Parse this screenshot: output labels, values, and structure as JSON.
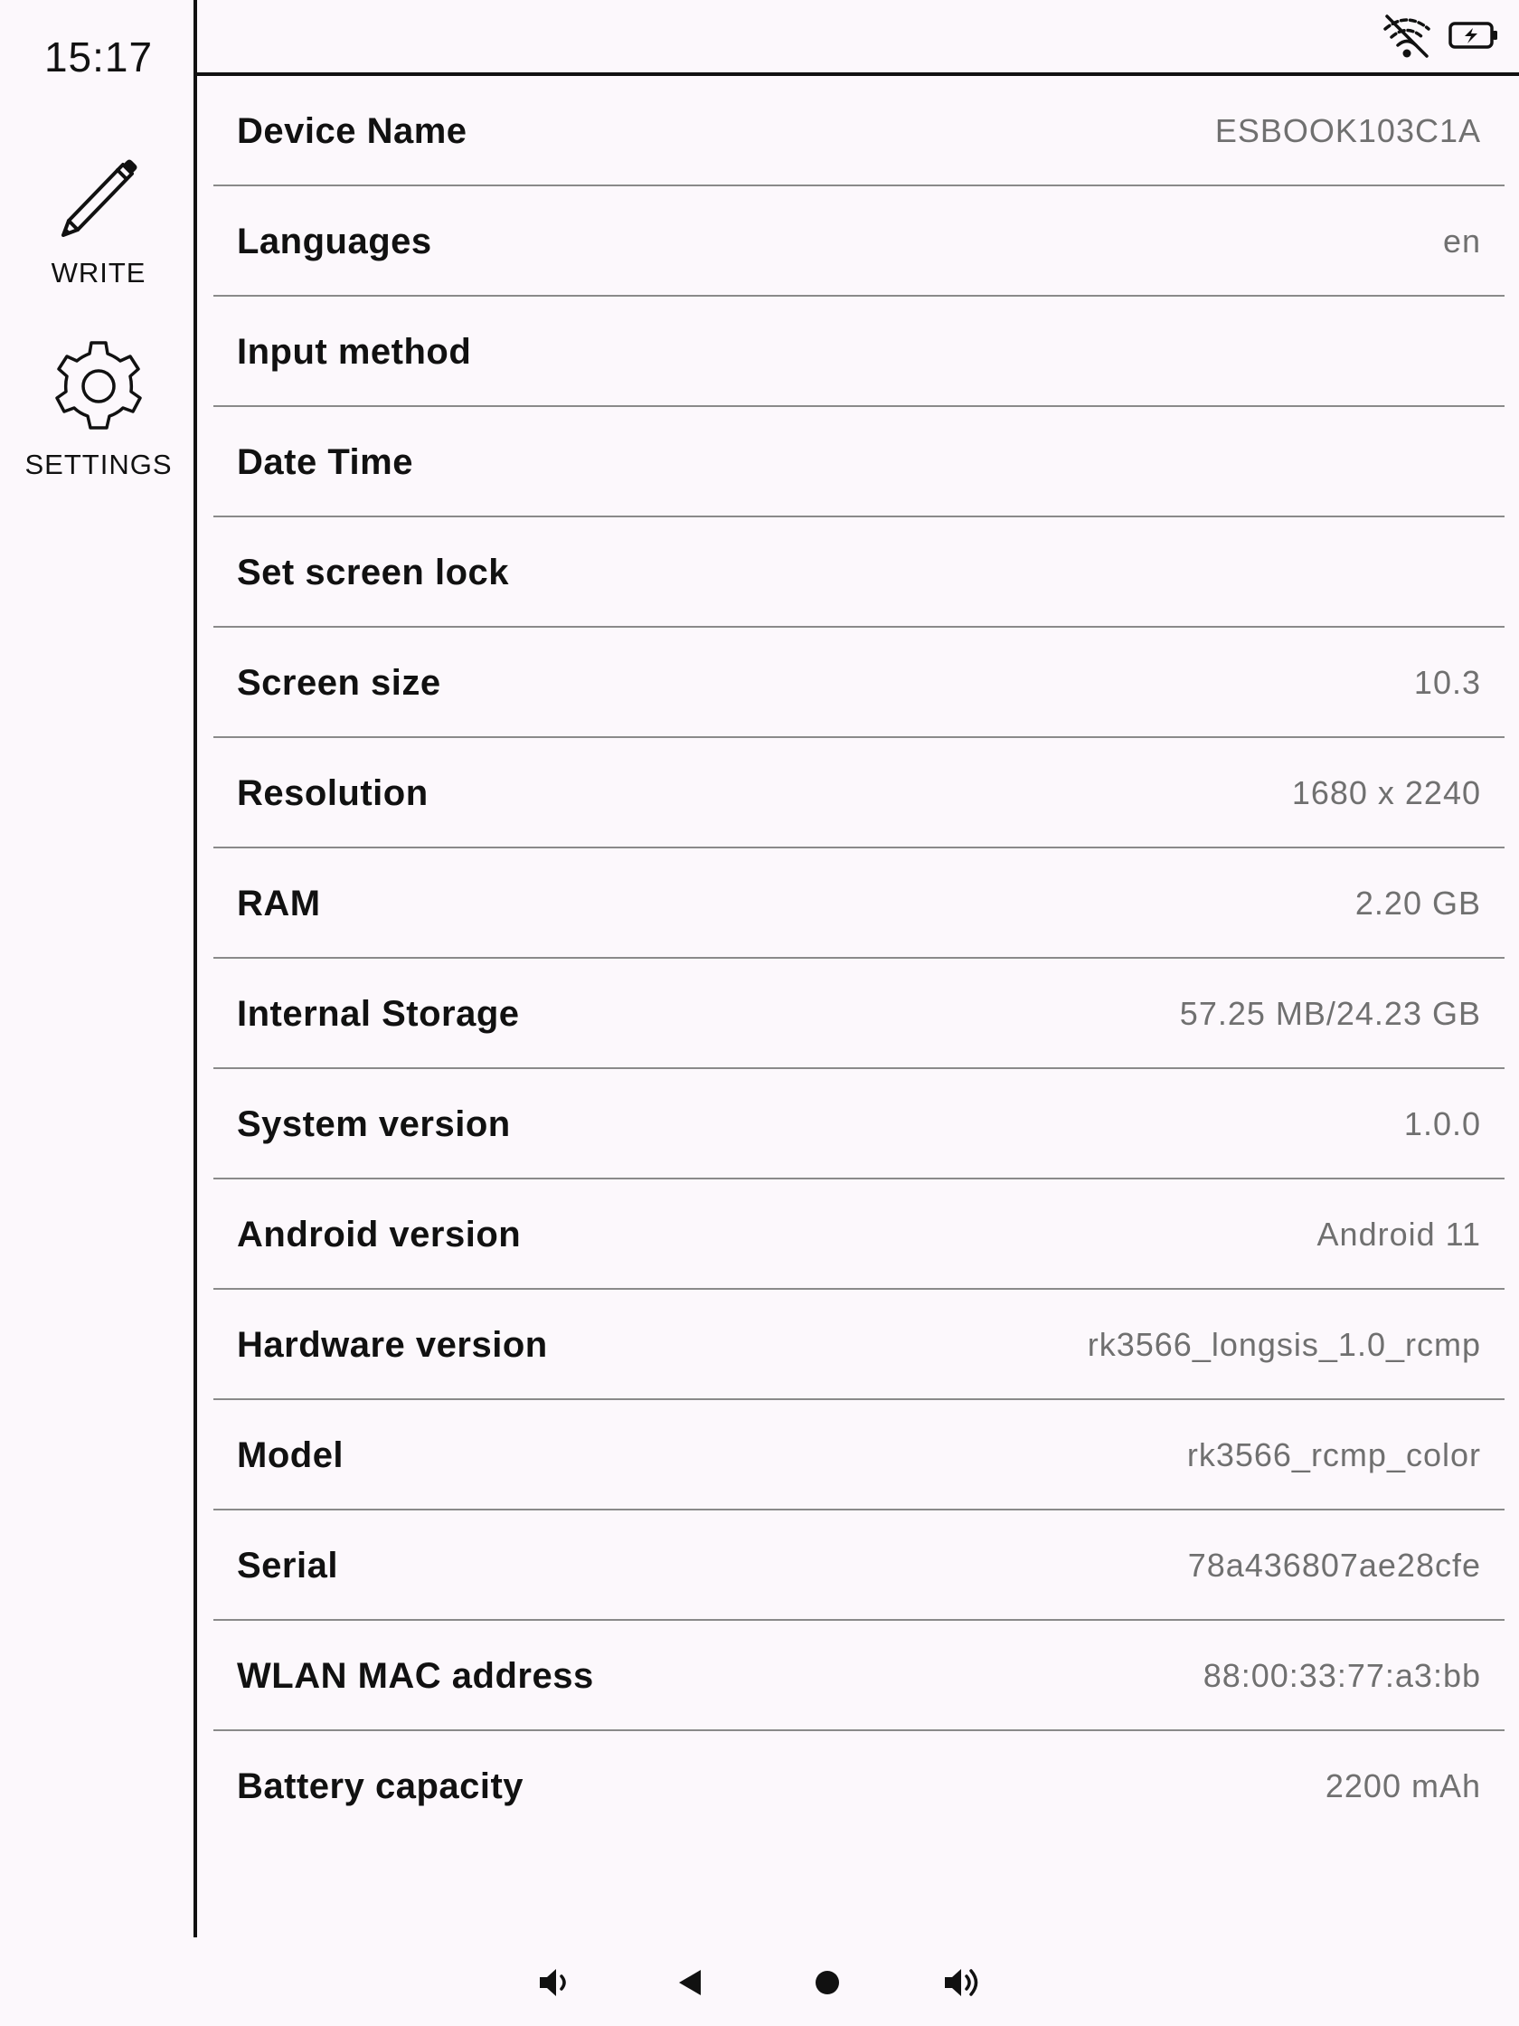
{
  "status_bar": {
    "time": "15:17",
    "wifi_icon": "wifi-off-icon",
    "battery_icon": "battery-charging-icon"
  },
  "sidebar": {
    "items": [
      {
        "label": "WRITE",
        "icon": "pencil-icon"
      },
      {
        "label": "SETTINGS",
        "icon": "gear-icon"
      }
    ]
  },
  "settings": {
    "rows": [
      {
        "label": "Device Name",
        "value": "ESBOOK103C1A"
      },
      {
        "label": "Languages",
        "value": "en"
      },
      {
        "label": "Input method",
        "value": ""
      },
      {
        "label": "Date Time",
        "value": ""
      },
      {
        "label": "Set screen lock",
        "value": ""
      },
      {
        "label": "Screen size",
        "value": "10.3"
      },
      {
        "label": "Resolution",
        "value": "1680 x 2240"
      },
      {
        "label": "RAM",
        "value": "2.20 GB"
      },
      {
        "label": "Internal Storage",
        "value": "57.25 MB/24.23 GB"
      },
      {
        "label": "System version",
        "value": "1.0.0"
      },
      {
        "label": "Android version",
        "value": "Android 11"
      },
      {
        "label": "Hardware version",
        "value": "rk3566_longsis_1.0_rcmp"
      },
      {
        "label": "Model",
        "value": "rk3566_rcmp_color"
      },
      {
        "label": "Serial",
        "value": "78a436807ae28cfe"
      },
      {
        "label": "WLAN MAC address",
        "value": "88:00:33:77:a3:bb"
      },
      {
        "label": "Battery capacity",
        "value": "2200 mAh"
      }
    ]
  },
  "navigation_bar": {
    "buttons": [
      "volume-down-icon",
      "back-icon",
      "home-icon",
      "volume-up-icon"
    ]
  }
}
